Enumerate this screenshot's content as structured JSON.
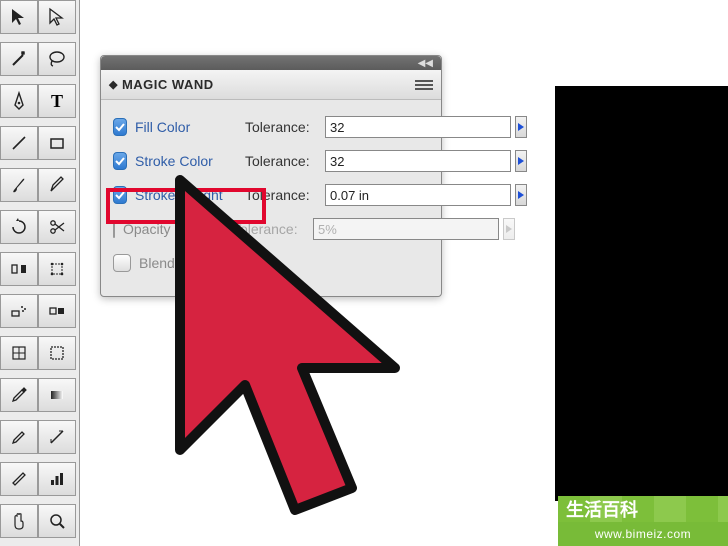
{
  "panel": {
    "title": "MAGIC WAND",
    "rows": [
      {
        "key": "fill",
        "label": "Fill Color",
        "tol_label": "Tolerance:",
        "value": "32",
        "checked": true,
        "disabled": false
      },
      {
        "key": "scolor",
        "label": "Stroke Color",
        "tol_label": "Tolerance:",
        "value": "32",
        "checked": true,
        "disabled": false
      },
      {
        "key": "sweight",
        "label": "Stroke Weight",
        "tol_label": "Tolerance:",
        "value": "0.07 in",
        "checked": true,
        "disabled": false
      },
      {
        "key": "opacity",
        "label": "Opacity",
        "tol_label": "Tolerance:",
        "value": "5%",
        "checked": false,
        "disabled": true
      },
      {
        "key": "blend",
        "label": "Blending Mode",
        "tol_label": "",
        "value": "",
        "checked": false,
        "disabled": true
      }
    ]
  },
  "watermark": {
    "text": "生活百科",
    "url": "www.bimeiz.com"
  },
  "colors": {
    "highlight": "#e1072e",
    "link_blue": "#2f5da8",
    "play_blue": "#1d4fd6"
  }
}
